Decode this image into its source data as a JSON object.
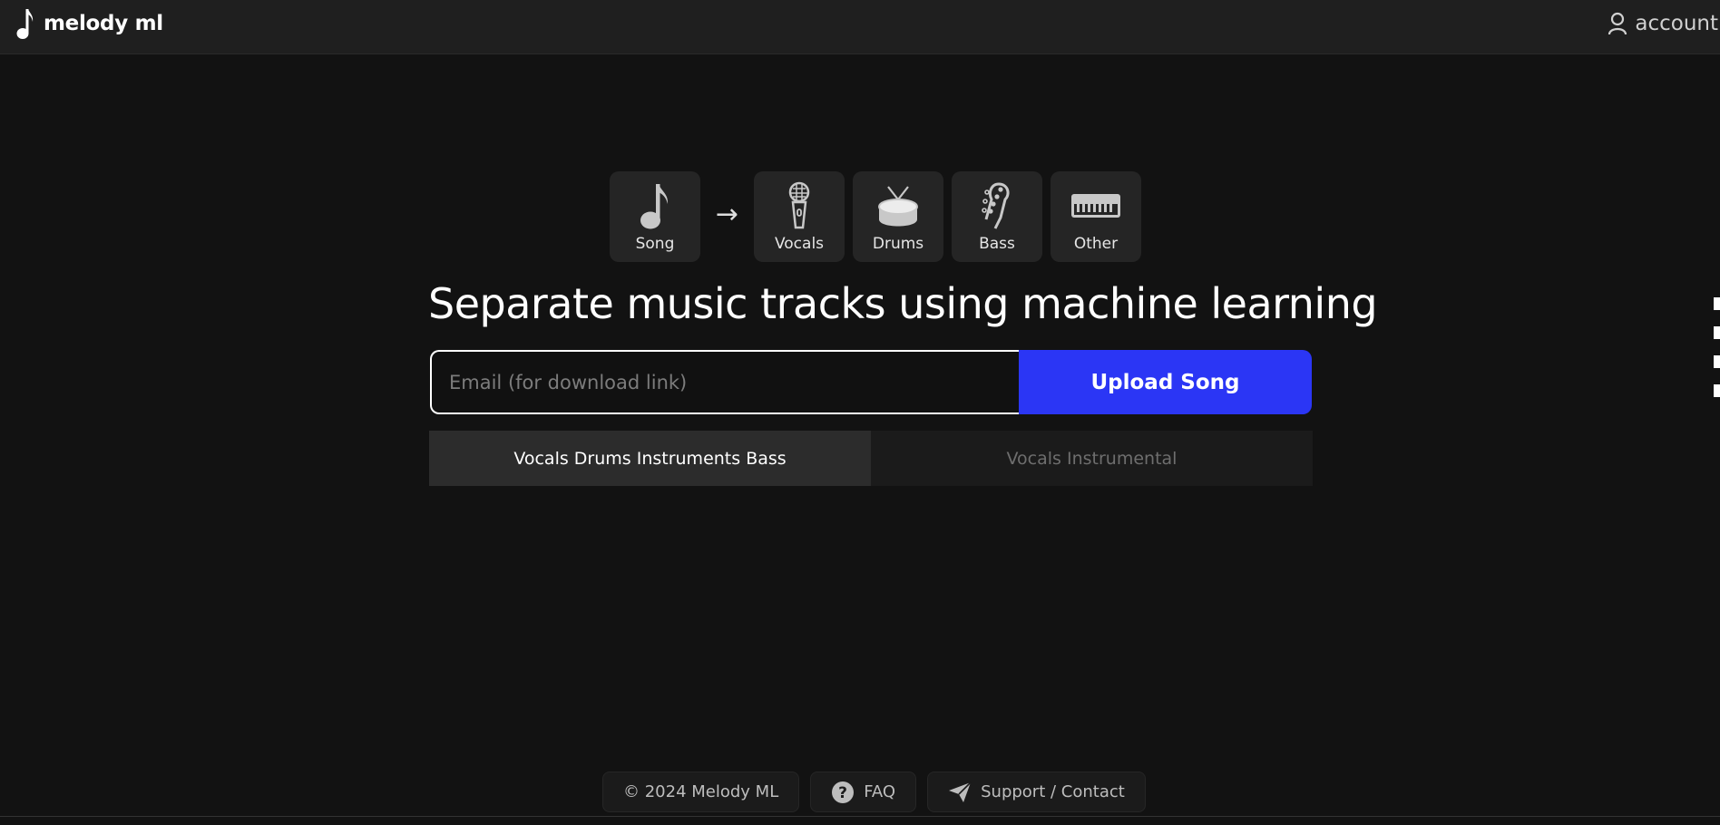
{
  "header": {
    "brand_name": "melody ml",
    "account_label": "account"
  },
  "stems": {
    "source": {
      "label": "Song",
      "icon": "music-note-icon"
    },
    "arrow": "→",
    "outputs": [
      {
        "label": "Vocals",
        "icon": "microphone-icon"
      },
      {
        "label": "Drums",
        "icon": "drum-icon"
      },
      {
        "label": "Bass",
        "icon": "bass-guitar-icon"
      },
      {
        "label": "Other",
        "icon": "keyboard-icon"
      }
    ]
  },
  "hero": {
    "title": "Separate music tracks using machine learning"
  },
  "upload": {
    "email_placeholder": "Email (for download link)",
    "email_value": "",
    "button_label": "Upload Song",
    "button_color": "#2b36f5"
  },
  "modes": {
    "options": [
      {
        "label": "Vocals Drums Instruments Bass",
        "selected": true
      },
      {
        "label": "Vocals Instrumental",
        "selected": false
      }
    ]
  },
  "footer": {
    "copyright": "© 2024 Melody ML",
    "faq_label": "FAQ",
    "support_label": "Support / Contact"
  },
  "colors": {
    "background": "#121212",
    "header": "#1f1f1f",
    "card": "#252525",
    "accent": "#2b36f5"
  }
}
